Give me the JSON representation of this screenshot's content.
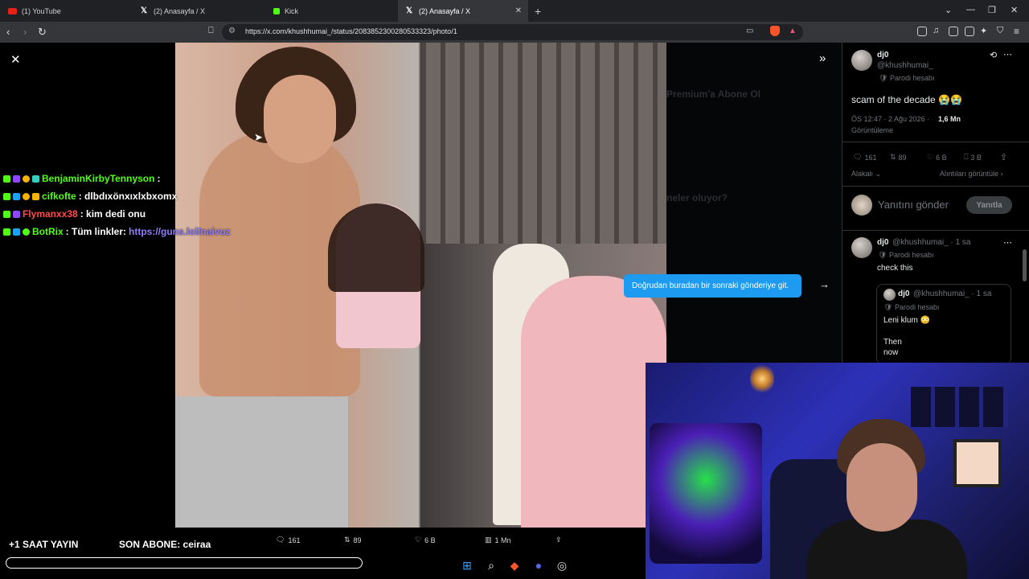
{
  "browser": {
    "tabs": [
      {
        "label": "(1) YouTube",
        "icon": "youtube-icon"
      },
      {
        "label": "(2) Anasayfa / X",
        "icon": "x-icon"
      },
      {
        "label": "Kick",
        "icon": "kick-icon"
      },
      {
        "label": "(2) Anasayfa / X",
        "icon": "x-icon",
        "active": true
      }
    ],
    "url": "https://x.com/khushhumai_/status/2083852300280533323/photo/1"
  },
  "chat": [
    {
      "user": "BenjaminKirbyTennyson",
      "message": ":",
      "user_color": "#53fc18"
    },
    {
      "user": "cifkofte",
      "message": ": dlbdıxönxıxlxbxomx",
      "user_color": "#53fc18"
    },
    {
      "user": "Flymanxx38",
      "message": ": kim dedi onu",
      "user_color": "#ff4b4b"
    },
    {
      "user": "BotRix",
      "message": ": Tüm linkler:",
      "link": "https://guns.lol/naivuz",
      "user_color": "#53fc18"
    }
  ],
  "tooltip": "Doğrudan buradan bir sonraki gönderiye git.",
  "media_stats": {
    "replies": "161",
    "reposts": "89",
    "likes": "6 B",
    "views": "1 Mn"
  },
  "stream_overlay": {
    "hours": "+1 SAAT YAYIN",
    "last_sub": "SON ABONE: ceiraa"
  },
  "post": {
    "name": "dj0",
    "handle": "@khushhumai_",
    "label": "Parodi hesabı",
    "text": "scam of the decade 😭😭",
    "time": "ÖS 12:47 · 2 Ağu 2026 ·",
    "views_count": "1,6 Mn",
    "views_label": "Görüntüleme",
    "replies": "161",
    "reposts": "89",
    "likes": "6 B",
    "bookmarks": "3 B",
    "relevant": "Alakalı",
    "quotes_link": "Alıntıları görüntüle"
  },
  "reply_box": {
    "placeholder": "Yanıtını gönder",
    "button": "Yanıtla"
  },
  "reply": {
    "name": "dj0",
    "handle": "@khushhumai_ · 1 sa",
    "label": "Parodi hesabı",
    "text": "check this",
    "quote": {
      "name": "dj0",
      "handle": "@khushhumai_ · 1 sa",
      "label": "Parodi hesabı",
      "line1": "Leni klum 😳",
      "line2": "Then",
      "line3": "now"
    }
  },
  "background_panel": {
    "premium": "Premium'a Abone Ol",
    "trends": "neler oluyor?"
  },
  "colors": {
    "accent": "#1d9bf0",
    "kick_green": "#53fc18",
    "tab_bg": "#202124"
  }
}
